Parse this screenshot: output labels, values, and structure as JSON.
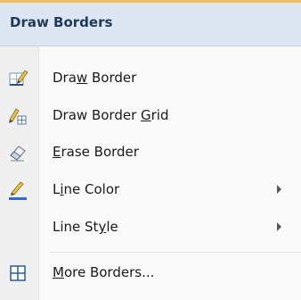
{
  "menu": {
    "header": "Draw Borders",
    "items": [
      {
        "pre": "Dra",
        "acc": "w",
        "post": " Border",
        "icon": "draw-border-icon",
        "has_submenu": false
      },
      {
        "pre": "Draw Border ",
        "acc": "G",
        "post": "rid",
        "icon": "draw-border-grid-icon",
        "has_submenu": false
      },
      {
        "pre": "",
        "acc": "E",
        "post": "rase Border",
        "icon": "eraser-icon",
        "has_submenu": false
      },
      {
        "pre": "L",
        "acc": "i",
        "post": "ne Color",
        "icon": "line-color-icon",
        "has_submenu": true
      },
      {
        "pre": "Line St",
        "acc": "y",
        "post": "le",
        "icon": "",
        "has_submenu": true
      },
      {
        "pre": "",
        "acc": "M",
        "post": "ore Borders...",
        "icon": "borders-icon",
        "has_submenu": false
      }
    ]
  },
  "colors": {
    "header_bg": "#dde7f3",
    "top_accent": "#f1c15f",
    "line_color_swatch": "#2e6bd6"
  }
}
